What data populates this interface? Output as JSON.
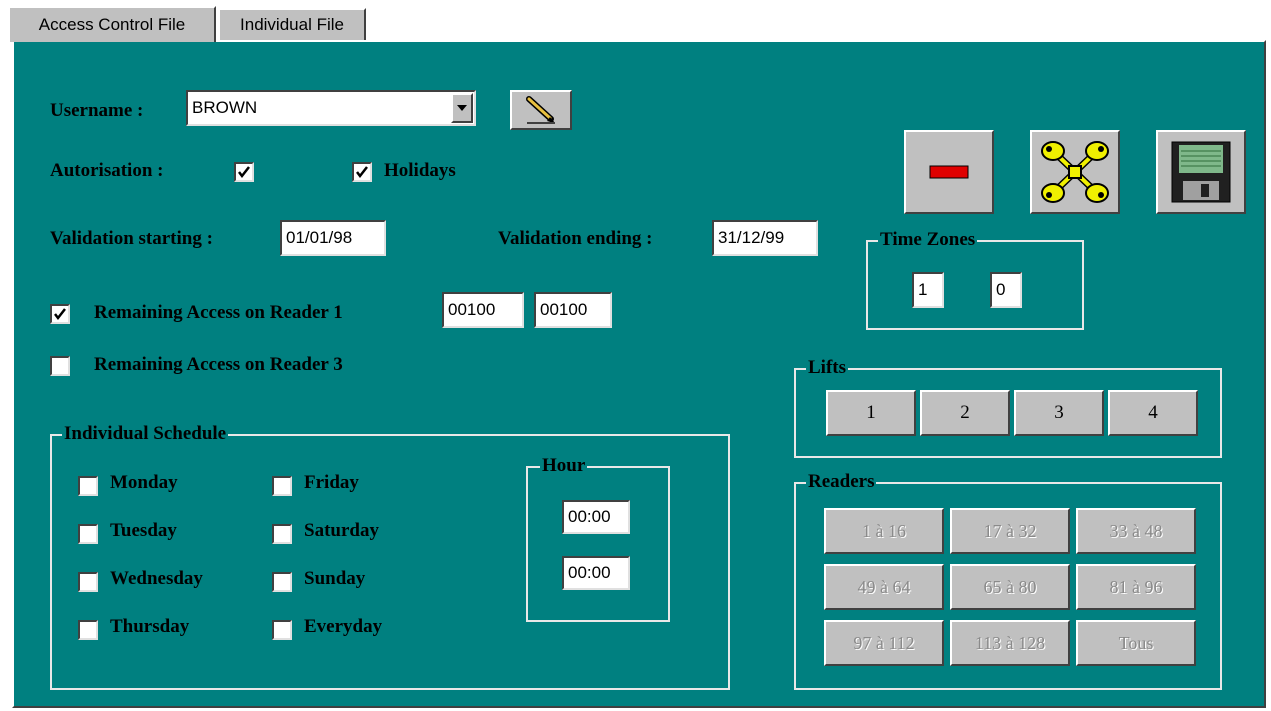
{
  "tabs": [
    {
      "label": "Access Control File",
      "active": true
    },
    {
      "label": "Individual File",
      "active": false
    }
  ],
  "form": {
    "username_label": "Username :",
    "username_value": "BROWN",
    "autorisation_label": "Autorisation :",
    "autorisation_checked": true,
    "holidays_label": "Holidays",
    "holidays_checked": true,
    "validation_start_label": "Validation starting :",
    "validation_start_value": "01/01/98",
    "validation_end_label": "Validation ending :",
    "validation_end_value": "31/12/99",
    "reader1_label": "Remaining Access on Reader 1",
    "reader1_checked": true,
    "reader1_value_a": "00100",
    "reader1_value_b": "00100",
    "reader3_label": "Remaining Access on Reader 3",
    "reader3_checked": false
  },
  "schedule": {
    "title": "Individual Schedule",
    "days_col1": [
      "Monday",
      "Tuesday",
      "Wednesday",
      "Thursday"
    ],
    "days_col2": [
      "Friday",
      "Saturday",
      "Sunday",
      "Everyday"
    ],
    "hour_title": "Hour",
    "hour_start": "00:00",
    "hour_end": "00:00"
  },
  "time_zones": {
    "title": "Time Zones",
    "zone1": "1",
    "zone2": "0"
  },
  "lifts": {
    "title": "Lifts",
    "buttons": [
      "1",
      "2",
      "3",
      "4"
    ]
  },
  "readers": {
    "title": "Readers",
    "buttons": [
      "1 à 16",
      "17 à 32",
      "33 à 48",
      "49 à 64",
      "65 à 80",
      "81 à 96",
      "97 à 112",
      "113 à 128",
      "Tous"
    ]
  },
  "colors": {
    "panel": "#008080",
    "button_face": "#c0c0c0",
    "delete_red": "#e00000",
    "keys_yellow": "#f0f000"
  },
  "icons": {
    "edit": "pencil-icon",
    "delete": "minus-icon",
    "keys": "keys-icon",
    "save": "floppy-disk-icon"
  }
}
